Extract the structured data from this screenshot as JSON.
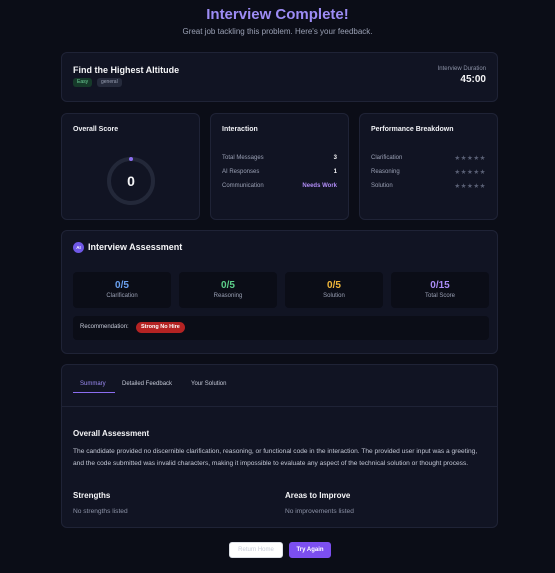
{
  "header": {
    "title": "Interview Complete!",
    "subtitle": "Great job tackling this problem. Here's your feedback."
  },
  "problem": {
    "name": "Find the Highest Altitude",
    "tags": [
      "Easy",
      "general"
    ],
    "duration_label": "Interview Duration",
    "duration_value": "45:00"
  },
  "overall_score": {
    "title": "Overall Score",
    "value": "0"
  },
  "interaction": {
    "title": "Interaction",
    "rows": [
      {
        "label": "Total Messages",
        "value": "3"
      },
      {
        "label": "AI Responses",
        "value": "1"
      },
      {
        "label": "Communication",
        "value": "Needs Work"
      }
    ]
  },
  "performance": {
    "title": "Performance Breakdown",
    "rows": [
      {
        "label": "Clarification",
        "stars": "★★★★★",
        "rating": 0
      },
      {
        "label": "Reasoning",
        "stars": "★★★★★",
        "rating": 0
      },
      {
        "label": "Solution",
        "stars": "★★★★★",
        "rating": 0
      }
    ]
  },
  "assessment": {
    "badge": "AI",
    "title": "Interview Assessment",
    "metrics": [
      {
        "value": "0/5",
        "label": "Clarification",
        "color": "#6aa0f0"
      },
      {
        "value": "0/5",
        "label": "Reasoning",
        "color": "#5ccf8a"
      },
      {
        "value": "0/5",
        "label": "Solution",
        "color": "#f2b83a"
      },
      {
        "value": "0/15",
        "label": "Total Score",
        "color": "#a98cf5"
      }
    ],
    "recommendation_label": "Recommendation:",
    "recommendation_value": "Strong No Hire"
  },
  "feedback": {
    "tabs": [
      "Summary",
      "Detailed Feedback",
      "Your Solution"
    ],
    "active_tab": "Summary",
    "overall_heading": "Overall Assessment",
    "overall_text": "The candidate provided no discernible clarification, reasoning, or functional code in the interaction. The provided user input was a greeting, and the code submitted was invalid characters, making it impossible to evaluate any aspect of the technical solution or thought process.",
    "strengths_heading": "Strengths",
    "strengths_text": "No strengths listed",
    "improve_heading": "Areas to Improve",
    "improve_text": "No improvements listed"
  },
  "actions": {
    "return_home": "Return Home",
    "try_again": "Try Again"
  },
  "colors": {
    "accent": "#9d8cf5",
    "danger": "#b42323",
    "button_primary": "#7c4ff0"
  }
}
